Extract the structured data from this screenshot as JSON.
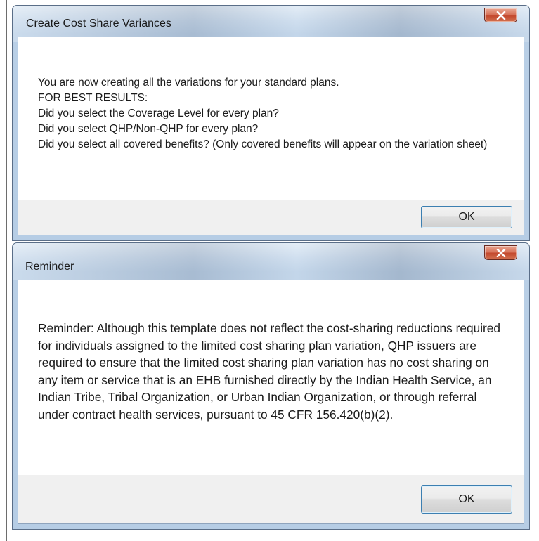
{
  "dialog1": {
    "title": "Create Cost Share Variances",
    "close_icon": "close-x-icon",
    "message": "You are now creating all the variations for your standard plans.\nFOR BEST RESULTS:\nDid you select the Coverage Level for every plan?\nDid you select QHP/Non-QHP for every plan?\nDid you select all covered benefits? (Only covered benefits will appear on the variation sheet)",
    "ok_label": "OK"
  },
  "dialog2": {
    "title": "Reminder",
    "close_icon": "close-x-icon",
    "message": "Reminder: Although this template does not reflect the cost-sharing reductions required for individuals assigned to the limited cost sharing plan variation, QHP issuers are required to ensure that the limited cost sharing plan variation has no cost sharing on any item or service that is an EHB furnished directly by the Indian Health Service, an Indian Tribe, Tribal Organization, or Urban Indian Organization, or through referral under contract health services, pursuant to 45 CFR 156.420(b)(2).",
    "ok_label": "OK"
  },
  "colors": {
    "frame": "#b9cfe6",
    "close_button": "#c3482d",
    "ok_border": "#3c7fb1"
  }
}
